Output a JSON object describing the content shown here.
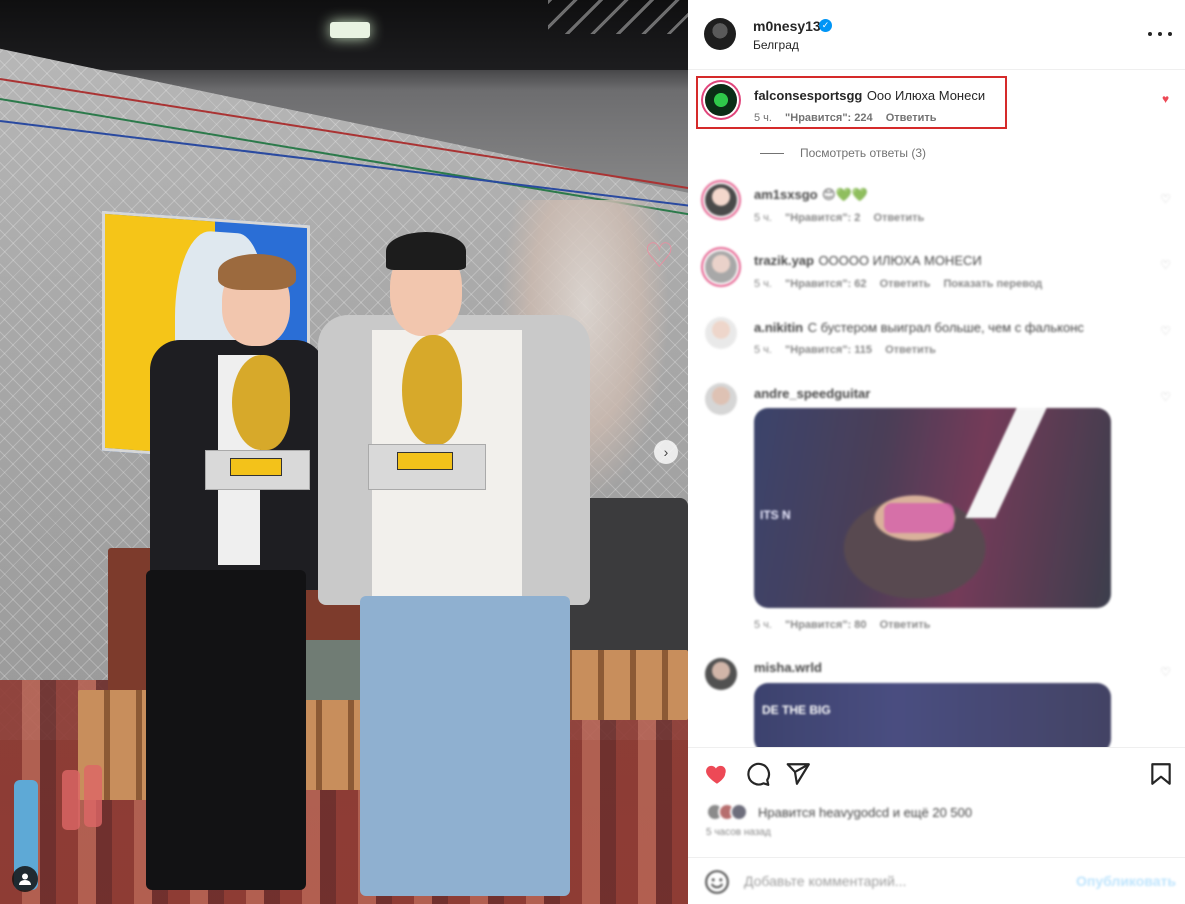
{
  "post": {
    "owner": {
      "username": "m0nesy13",
      "verified_mark": "✓",
      "location": "Белград"
    },
    "carousel_next": "›"
  },
  "comments": {
    "highlighted": {
      "username": "falconsesportsgg",
      "text": "Ооо Илюха Монеси",
      "time": "5 ч.",
      "likes": "\"Нравится\": 224",
      "reply": "Ответить",
      "view_replies": "Посмотреть ответы (3)"
    },
    "items": [
      {
        "username": "am1sxsgo",
        "text": "😊💚💚",
        "time": "5 ч.",
        "likes": "\"Нравится\": 2",
        "reply": "Ответить",
        "translate": ""
      },
      {
        "username": "trazik.yap",
        "text": "ООООО ИЛЮХА МОНЕСИ",
        "time": "5 ч.",
        "likes": "\"Нравится\": 62",
        "reply": "Ответить",
        "translate": "Показать перевод"
      },
      {
        "username": "a.nikitin",
        "text": "С бустером выиграл больше, чем с фальконс",
        "time": "5 ч.",
        "likes": "\"Нравится\": 115",
        "reply": "Ответить",
        "translate": ""
      },
      {
        "username": "andre_speedguitar",
        "text": "",
        "time": "5 ч.",
        "likes": "\"Нравится\": 80",
        "reply": "Ответить",
        "translate": "",
        "gif_text": "ITS N"
      },
      {
        "username": "misha.wrld",
        "text": "",
        "time": "",
        "likes": "",
        "reply": "",
        "translate": "",
        "gif_text": "DE THE BIG"
      }
    ]
  },
  "actions": {
    "likes_text": "Нравится heavygodcd и ещё 20 500",
    "time_ago": "5 часов назад"
  },
  "add_comment": {
    "placeholder": "Добавьте комментарий...",
    "post_label": "Опубликовать"
  },
  "colors": {
    "accent_blue": "#0095f6",
    "like_red": "#ed4956",
    "highlight_border": "#d52a2a"
  }
}
